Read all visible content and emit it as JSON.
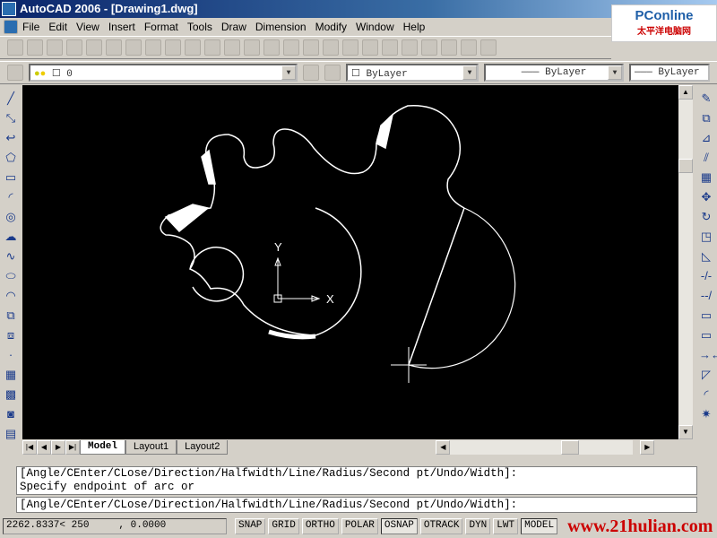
{
  "window": {
    "title": "AutoCAD 2006 - [Drawing1.dwg]"
  },
  "logo": {
    "text": "PConline",
    "sub": "太平洋电脑网"
  },
  "menu": [
    "File",
    "Edit",
    "View",
    "Insert",
    "Format",
    "Tools",
    "Draw",
    "Dimension",
    "Modify",
    "Window",
    "Help"
  ],
  "layer": {
    "current": "0"
  },
  "properties": {
    "color": "ByLayer",
    "linetype": "ByLayer",
    "lineweight": "ByLayer"
  },
  "tabs": {
    "model": "Model",
    "layout1": "Layout1",
    "layout2": "Layout2"
  },
  "command": {
    "history": [
      "[Angle/CEnter/CLose/Direction/Halfwidth/Line/Radius/Second pt/Undo/Width]:",
      "Specify endpoint of arc or"
    ],
    "prompt": "[Angle/CEnter/CLose/Direction/Halfwidth/Line/Radius/Second pt/Undo/Width]:"
  },
  "status": {
    "coords": "2262.8337< 250     , 0.0000",
    "buttons": [
      {
        "label": "SNAP",
        "on": false
      },
      {
        "label": "GRID",
        "on": false
      },
      {
        "label": "ORTHO",
        "on": false
      },
      {
        "label": "POLAR",
        "on": false
      },
      {
        "label": "OSNAP",
        "on": true
      },
      {
        "label": "OTRACK",
        "on": false
      },
      {
        "label": "DYN",
        "on": false
      },
      {
        "label": "LWT",
        "on": false
      },
      {
        "label": "MODEL",
        "on": true
      }
    ],
    "watermark": "www.21hulian.com"
  },
  "ucs": {
    "x": "X",
    "y": "Y"
  }
}
